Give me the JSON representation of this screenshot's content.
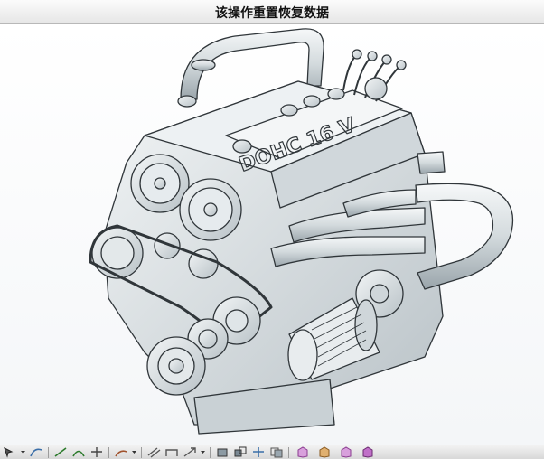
{
  "title_bar": {
    "message": "该操作重置恢复数据"
  },
  "viewport": {
    "model": "engine-3d-model",
    "engraving": "DOHC 16 V"
  },
  "toolbar": {
    "groups": [
      {
        "icons": [
          "select-icon",
          "dropdown-icon",
          "curve-icon"
        ]
      },
      {
        "icons": [
          "sketch-line-icon",
          "sketch-arc-icon",
          "trim-icon"
        ]
      },
      {
        "icons": [
          "edit-curve-icon",
          "dropdown-icon"
        ]
      },
      {
        "icons": [
          "offset-icon",
          "bridge-icon",
          "extend-icon",
          "dropdown-icon"
        ]
      },
      {
        "icons": [
          "box-icon",
          "transform-icon",
          "move-icon",
          "copy-icon"
        ]
      },
      {
        "icons": [
          "view-cube-top-icon",
          "view-cube-front-icon",
          "view-cube-right-icon",
          "view-cube-iso-icon"
        ]
      }
    ]
  },
  "colors": {
    "model_fill": "#dde3e6",
    "model_stroke": "#30363a",
    "accent_cube": "#c060c8"
  }
}
